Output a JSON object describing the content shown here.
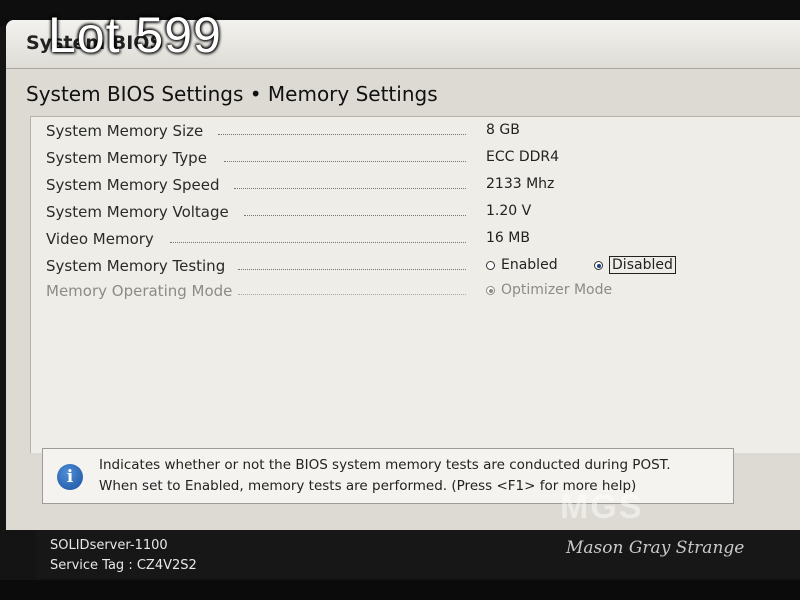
{
  "app": {
    "title": "System BIOS"
  },
  "overlay": {
    "lot_label": "Lot 599",
    "watermark_name": "Mason Gray Strange"
  },
  "page": {
    "title": "System BIOS Settings • Memory Settings"
  },
  "settings": [
    {
      "label": "System Memory Size",
      "value": "8 GB"
    },
    {
      "label": "System Memory Type",
      "value": "ECC DDR4"
    },
    {
      "label": "System Memory Speed",
      "value": "2133 Mhz"
    },
    {
      "label": "System Memory Voltage",
      "value": "1.20 V"
    },
    {
      "label": "Video Memory",
      "value": "16 MB"
    },
    {
      "label": "System Memory Testing",
      "options": [
        "Enabled",
        "Disabled"
      ],
      "selected": "Disabled"
    },
    {
      "label": "Memory Operating Mode",
      "options": [
        "Optimizer Mode"
      ],
      "selected": "Optimizer Mode",
      "disabled": true
    }
  ],
  "help": {
    "icon": "info-icon",
    "line1": "Indicates whether or not the BIOS system memory tests are conducted during POST.",
    "line2": "When set to Enabled, memory tests are performed. (Press <F1> for more help)"
  },
  "status": {
    "server": "SOLIDserver-1100",
    "service_tag": "Service Tag : CZ4V2S2"
  },
  "colors": {
    "selected_radio": "#1b3f8a",
    "status_bar": "#171717",
    "info_icon": "#1b4f9e"
  }
}
